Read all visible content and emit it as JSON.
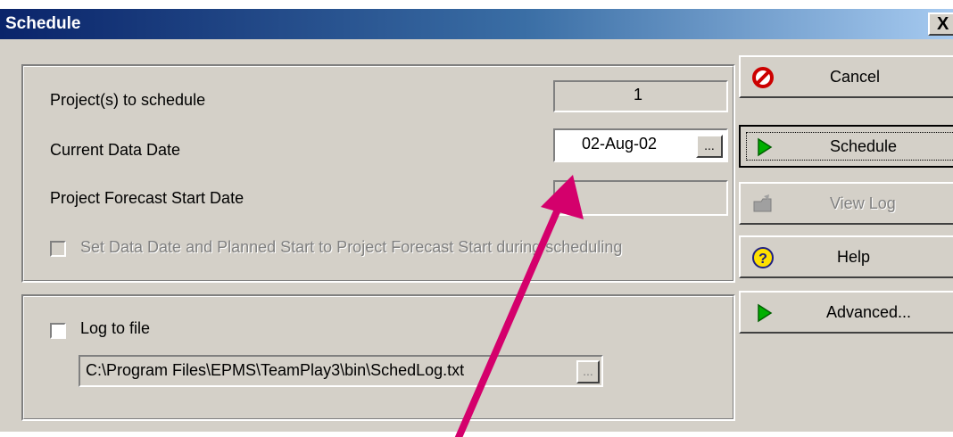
{
  "window": {
    "title": "Schedule",
    "close_label": "X"
  },
  "schedule_group": {
    "projects_label": "Project(s) to schedule",
    "projects_value": "1",
    "data_date_label": "Current Data Date",
    "data_date_value": "02-Aug-02",
    "data_date_button": "...",
    "forecast_label": "Project Forecast Start Date",
    "forecast_value": "",
    "set_data_date_label": "Set Data Date and Planned Start to Project Forecast Start during scheduling",
    "set_data_date_checked": false
  },
  "log_group": {
    "log_label": "Log to file",
    "log_checked": false,
    "log_path": "C:\\Program Files\\EPMS\\TeamPlay3\\bin\\SchedLog.txt",
    "browse_button": "..."
  },
  "buttons": {
    "cancel": "Cancel",
    "schedule": "Schedule",
    "view_log": "View Log",
    "help": "Help",
    "advanced": "Advanced..."
  },
  "icons": {
    "cancel": "cancel-icon",
    "schedule": "play-icon",
    "view_log": "folder-icon",
    "help": "help-icon",
    "advanced": "play-icon"
  },
  "colors": {
    "annotation_arrow": "#d4006c",
    "dialog_bg": "#d4d0c8",
    "title_start": "#0a246a",
    "title_end": "#a6caf0"
  }
}
